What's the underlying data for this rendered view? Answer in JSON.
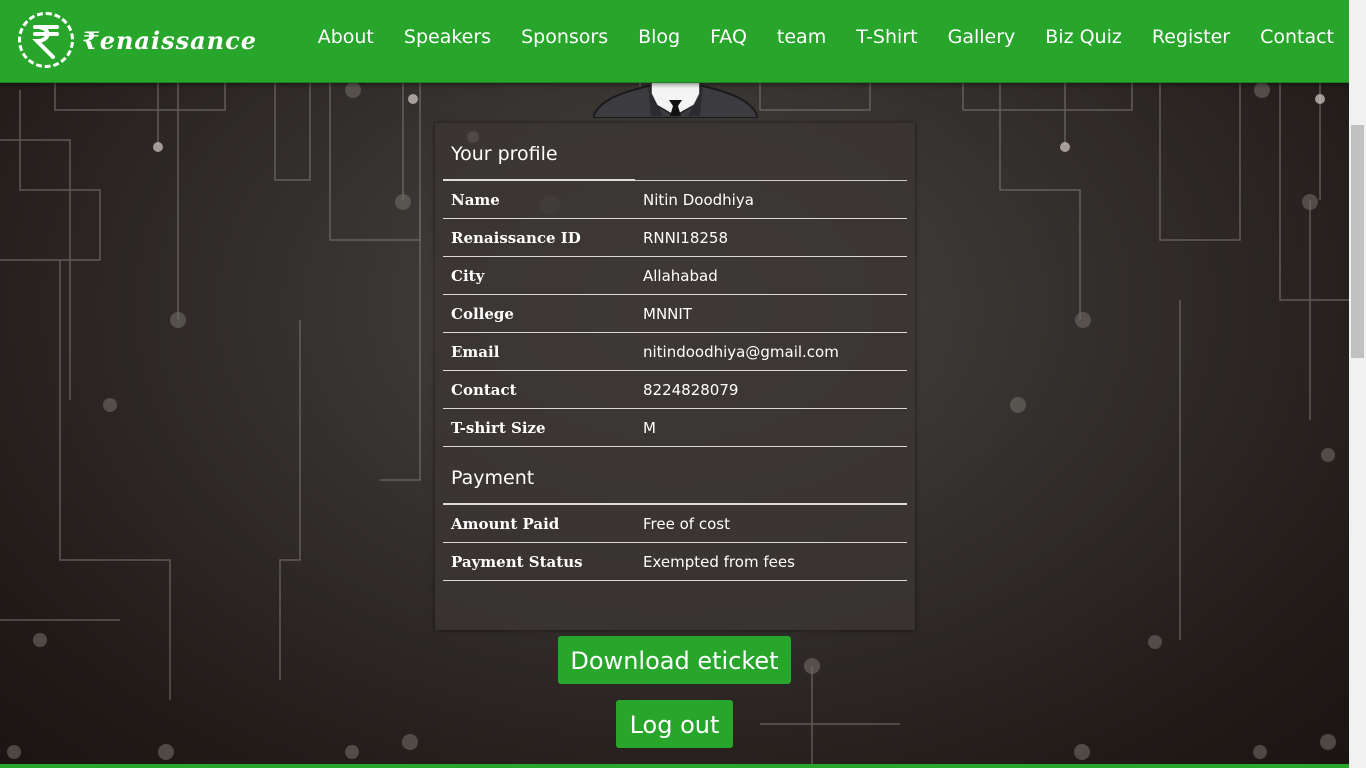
{
  "brand": {
    "logo_text": "₹enaissance",
    "accent": "#28a62c"
  },
  "nav": [
    {
      "label": "About"
    },
    {
      "label": "Speakers"
    },
    {
      "label": "Sponsors"
    },
    {
      "label": "Blog"
    },
    {
      "label": "FAQ"
    },
    {
      "label": "team"
    },
    {
      "label": "T-Shirt"
    },
    {
      "label": "Gallery"
    },
    {
      "label": "Biz Quiz"
    },
    {
      "label": "Register"
    },
    {
      "label": "Contact"
    }
  ],
  "profile": {
    "heading": "Your profile",
    "rows": [
      {
        "key": "Name",
        "value": "Nitin Doodhiya"
      },
      {
        "key": "Renaissance ID",
        "value": "RNNI18258"
      },
      {
        "key": "City",
        "value": "Allahabad"
      },
      {
        "key": "College",
        "value": "MNNIT"
      },
      {
        "key": "Email",
        "value": "nitindoodhiya@gmail.com"
      },
      {
        "key": "Contact",
        "value": "8224828079"
      },
      {
        "key": "T-shirt Size",
        "value": "M"
      }
    ]
  },
  "payment": {
    "heading": "Payment",
    "rows": [
      {
        "key": "Amount Paid",
        "value": "Free of cost"
      },
      {
        "key": "Payment Status",
        "value": "Exempted from fees"
      }
    ]
  },
  "actions": {
    "download_label": "Download eticket",
    "logout_label": "Log out"
  }
}
